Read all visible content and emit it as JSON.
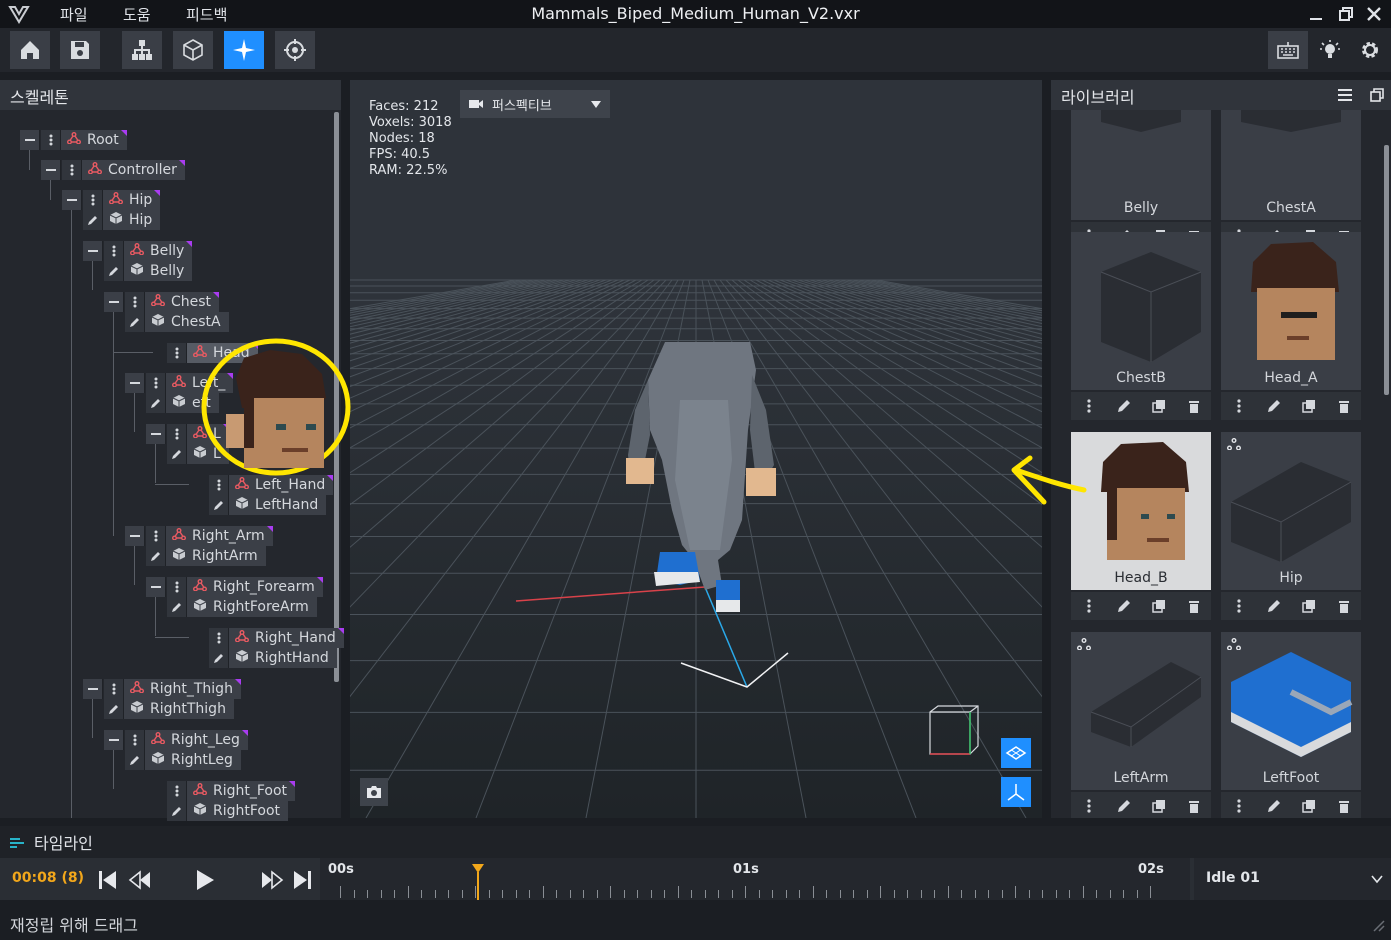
{
  "window": {
    "title": "Mammals_Biped_Medium_Human_V2.vxr",
    "menu": [
      "파일",
      "도움",
      "피드백"
    ]
  },
  "toolbar": {
    "left_tools": [
      "home-icon",
      "save-icon",
      "hierarchy-icon",
      "cube-icon",
      "sparkle-icon",
      "crosshair-icon"
    ],
    "active_tool": "sparkle-icon",
    "accent": "#1f8fff",
    "right_tools": [
      "keyboard-icon",
      "lightbulb-icon",
      "gear-icon"
    ]
  },
  "skeleton": {
    "title": "스켈레톤",
    "nodes": [
      {
        "bone": "Root"
      },
      {
        "bone": "Controller"
      },
      {
        "bone": "Hip",
        "mesh": "Hip"
      },
      {
        "bone": "Belly",
        "mesh": "Belly"
      },
      {
        "bone": "Chest",
        "mesh": "ChestA"
      },
      {
        "bone": "Head"
      },
      {
        "bone": "Left_",
        "mesh": "eft"
      },
      {
        "bone": "L",
        "mesh": "L"
      },
      {
        "bone": "Left_Hand",
        "mesh": "LeftHand"
      },
      {
        "bone": "Right_Arm",
        "mesh": "RightArm"
      },
      {
        "bone": "Right_Forearm",
        "mesh": "RightForeArm"
      },
      {
        "bone": "Right_Hand",
        "mesh": "RightHand"
      },
      {
        "bone": "Right_Thigh",
        "mesh": "RightThigh"
      },
      {
        "bone": "Right_Leg",
        "mesh": "RightLeg"
      },
      {
        "bone": "Right_Foot",
        "mesh": "RightFoot"
      }
    ]
  },
  "viewport": {
    "stats": [
      "Faces: 212",
      "Voxels: 3018",
      "Nodes: 18",
      "FPS: 40.5",
      "RAM: 22.5%"
    ],
    "camera_mode": "퍼스펙티브"
  },
  "library": {
    "title": "라이브러리",
    "items": [
      "Belly",
      "ChestA",
      "ChestB",
      "Head_A",
      "Head_B",
      "Hip",
      "LeftArm",
      "LeftFoot"
    ],
    "selected": "Head_B"
  },
  "timeline": {
    "title": "타임라인",
    "current_time": "00:08 (8)",
    "ruler_labels": [
      "00s",
      "01s",
      "02s"
    ],
    "playhead_fraction": 0.17,
    "clip": "Idle 01"
  },
  "status": {
    "text": "재정립 위해 드래그"
  }
}
